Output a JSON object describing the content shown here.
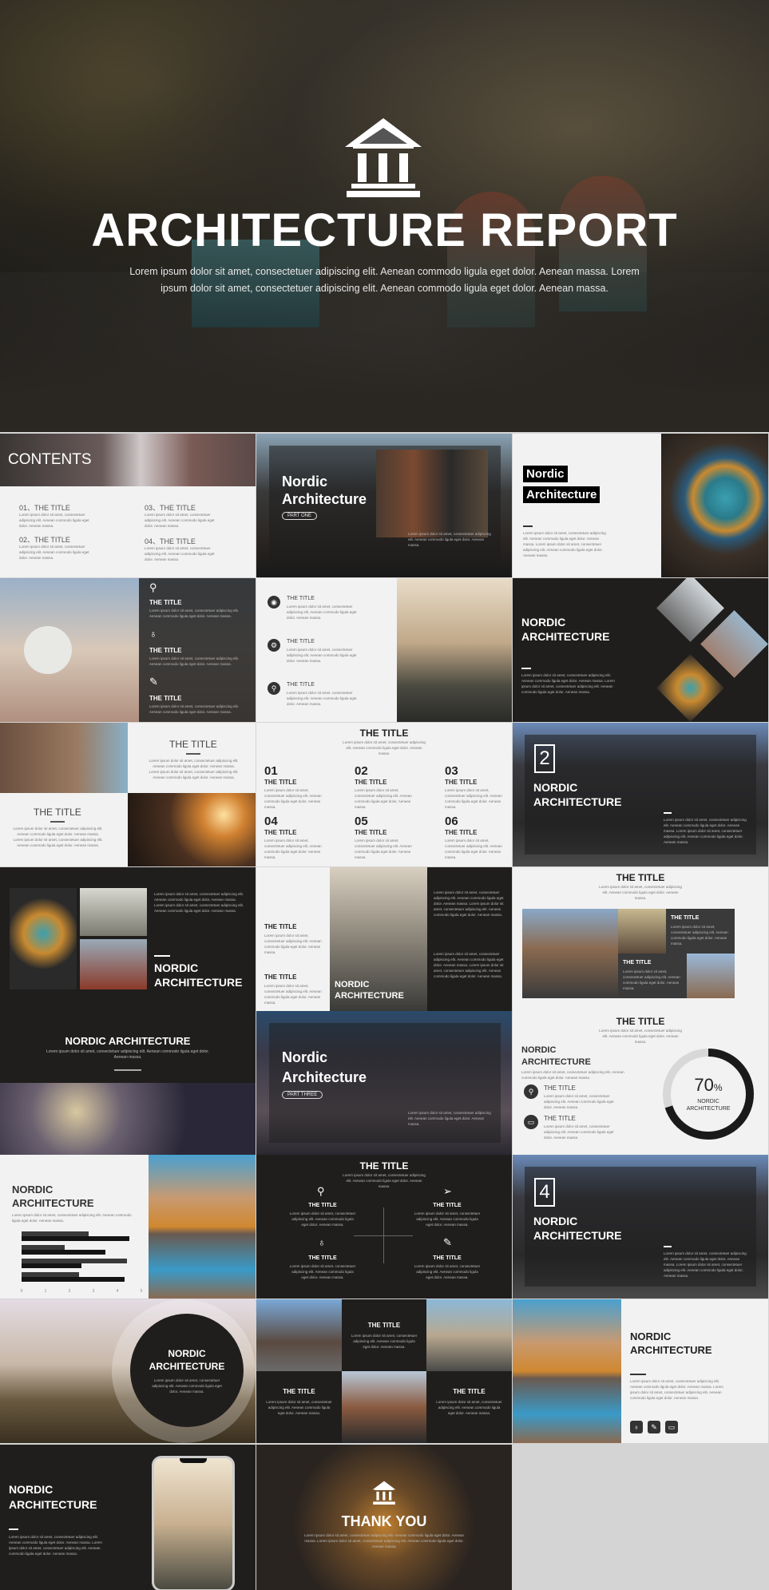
{
  "hero": {
    "title": "ARCHITECTURE REPORT",
    "subtitle": "Lorem ipsum dolor sit amet, consectetuer adipiscing elit. Aenean commodo ligula eget dolor. Aenean massa. Lorem ipsum dolor sit amet, consectetuer adipiscing elit. Aenean commodo ligula eget dolor. Aenean massa.",
    "logo_icon": "classical-building-icon"
  },
  "lorem": "Lorem ipsum dolor sit amet, consectetuer adipiscing elit. Aenean commodo ligula eget dolor. Aenean massa.",
  "lorem_long": "Lorem ipsum dolor sit amet, consectetuer adipiscing elit. Aenean commodo ligula eget dolor. Aenean massa. Lorem ipsum dolor sit amet, consectetuer adipiscing elit. Aenean commodo ligula eget dolor. Aenean massa.",
  "the_title": "THE TITLE",
  "nordic_upper": "NORDIC ARCHITECTURE",
  "nordic_word": "Nordic",
  "architecture_word": "Architecture",
  "nordic_caps": "NORDIC",
  "architecture_caps": "ARCHITECTURE",
  "contents": {
    "heading": "CONTENTS",
    "items": [
      "01、THE TITLE",
      "02、THE TITLE",
      "03、THE TITLE",
      "04、THE TITLE"
    ]
  },
  "part_one": "PART ONE",
  "part_three": "PART THREE",
  "numbered": [
    "01",
    "02",
    "03",
    "04",
    "05",
    "06"
  ],
  "section_numbers": [
    "2",
    "4"
  ],
  "progress": {
    "value": "70",
    "unit": "%",
    "fraction": 0.7
  },
  "thank_you": "THANK YOU",
  "chart_data": {
    "type": "bar",
    "orientation": "horizontal",
    "ticks": [
      "0",
      "1",
      "2",
      "3",
      "4",
      "5"
    ],
    "xlim": [
      0,
      5
    ],
    "series": [
      {
        "color": "#3a3a3a",
        "values": [
          2.8,
          1.8,
          4.4,
          2.4
        ]
      },
      {
        "color": "#141414",
        "values": [
          4.5,
          3.5,
          2.5,
          4.3
        ]
      }
    ]
  },
  "colors": {
    "dark": "#1f1e1c",
    "light": "#f2f2f2",
    "ring_fill": "#1a1a1a",
    "ring_track": "#d8d8d8"
  }
}
